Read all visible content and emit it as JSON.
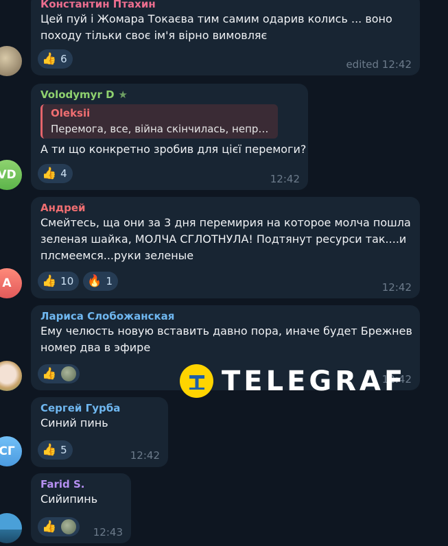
{
  "colors": {
    "background": "#0e1621",
    "bubble": "#182533",
    "reaction_bg": "#263c54",
    "timestamp": "#6c7b8b",
    "name_pink": "#ec6e8f",
    "name_green": "#8fd16f",
    "name_red": "#ef6e71",
    "name_blue": "#6fb7f0",
    "name_purple": "#b690f2",
    "watermark_yellow": "#ffd400"
  },
  "messages": [
    {
      "author": "Константин Птахин",
      "lines": [
        "Цей пуй і Жомара Токаєва тим самим одарив колись ... воно",
        "походу тільки своє ім'я вірно вимовляє"
      ],
      "reactions": [
        {
          "icon": "thumbs-up-icon",
          "emoji": "👍",
          "count": "6"
        }
      ],
      "time": "edited 12:42"
    },
    {
      "author": "Volodymyr D",
      "author_badge": "star-icon",
      "reply": {
        "author": "Oleksii",
        "text": "Перемога, все, війна скінчилась, неправ…"
      },
      "lines": [
        "А ти що конкретно зробив для цієї перемоги?"
      ],
      "reactions": [
        {
          "icon": "thumbs-up-icon",
          "emoji": "👍",
          "count": "4"
        }
      ],
      "time": "12:42",
      "avatar_initials": "VD"
    },
    {
      "author": "Андрей",
      "lines": [
        "Смейтесь, ща они за 3 дня перемирия на которое молча пошла",
        "зеленая шайка, МОЛЧА СГЛОТНУЛА!  Подтянут ресурси так....и",
        "плсмеемся...руки зеленые"
      ],
      "reactions": [
        {
          "icon": "thumbs-up-icon",
          "emoji": "👍",
          "count": "10"
        },
        {
          "icon": "fire-icon",
          "emoji": "🔥",
          "count": "1"
        }
      ],
      "time": "12:42",
      "avatar_initials": "А"
    },
    {
      "author": "Лариса Слобожанская",
      "lines": [
        "Ему челюсть новую вставить давно пора, иначе будет Брежнев",
        "номер два в эфире"
      ],
      "reactions": [
        {
          "icon": "thumbs-up-icon",
          "emoji": "👍",
          "count": ""
        }
      ],
      "time": "12:42"
    },
    {
      "author": "Сергей Гурба",
      "lines": [
        "Синий пинь"
      ],
      "reactions": [
        {
          "icon": "thumbs-up-icon",
          "emoji": "👍",
          "count": "5"
        }
      ],
      "time": "12:42",
      "avatar_initials": "СГ"
    },
    {
      "author": "Farid S.",
      "lines": [
        "Сийипинь"
      ],
      "reactions": [
        {
          "icon": "thumbs-up-icon",
          "emoji": "👍",
          "count": ""
        }
      ],
      "time": "12:43"
    }
  ],
  "watermark": {
    "text": "TELEGRAF",
    "logo_letter": "T"
  }
}
